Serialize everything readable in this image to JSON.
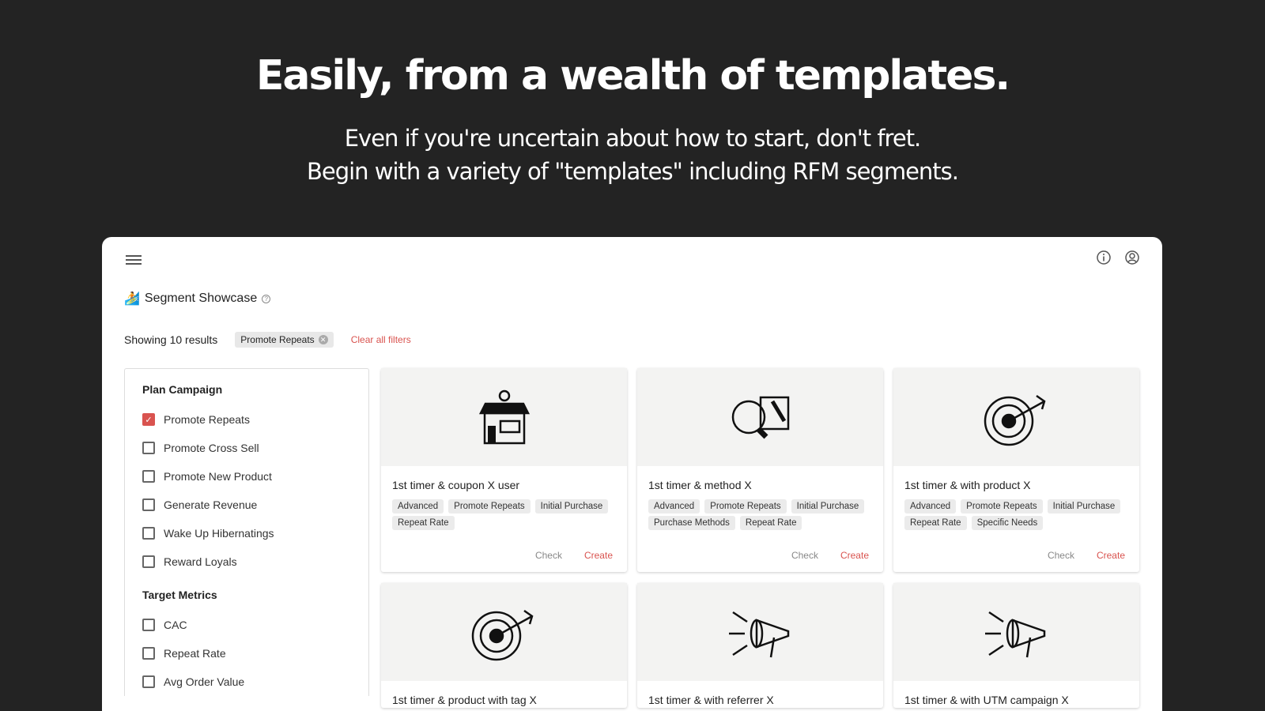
{
  "hero": {
    "title": "Easily, from a wealth of templates.",
    "line1": "Even if you're uncertain about how to start, don't fret.",
    "line2": "Begin with a variety of \"templates\" including RFM segments."
  },
  "page": {
    "title": "Segment Showcase",
    "icon": "surfer-emoji",
    "help": "?"
  },
  "filters": {
    "results": "Showing 10 results",
    "chip": "Promote Repeats",
    "clear": "Clear all filters"
  },
  "accent": "#d9534f",
  "sidebar": {
    "groups": [
      {
        "title": "Plan Campaign",
        "options": [
          {
            "label": "Promote Repeats",
            "checked": true
          },
          {
            "label": "Promote Cross Sell",
            "checked": false
          },
          {
            "label": "Promote New Product",
            "checked": false
          },
          {
            "label": "Generate Revenue",
            "checked": false
          },
          {
            "label": "Wake Up Hibernatings",
            "checked": false
          },
          {
            "label": "Reward Loyals",
            "checked": false
          }
        ]
      },
      {
        "title": "Target Metrics",
        "options": [
          {
            "label": "CAC",
            "checked": false
          },
          {
            "label": "Repeat Rate",
            "checked": false
          },
          {
            "label": "Avg Order Value",
            "checked": false
          }
        ]
      }
    ]
  },
  "cards": [
    {
      "title": "1st timer & coupon X user",
      "icon": "store",
      "tags": [
        "Advanced",
        "Promote Repeats",
        "Initial Purchase",
        "Repeat Rate"
      ]
    },
    {
      "title": "1st timer & method X",
      "icon": "magnifier-boxes",
      "tags": [
        "Advanced",
        "Promote Repeats",
        "Initial Purchase",
        "Purchase Methods",
        "Repeat Rate"
      ]
    },
    {
      "title": "1st timer & with product X",
      "icon": "target",
      "tags": [
        "Advanced",
        "Promote Repeats",
        "Initial Purchase",
        "Repeat Rate",
        "Specific Needs"
      ]
    },
    {
      "title": "1st timer & product with tag X",
      "icon": "target",
      "tags": []
    },
    {
      "title": "1st timer & with referrer X",
      "icon": "megaphone",
      "tags": []
    },
    {
      "title": "1st timer & with UTM campaign X",
      "icon": "megaphone",
      "tags": []
    }
  ],
  "card_actions": {
    "check": "Check",
    "create": "Create"
  }
}
